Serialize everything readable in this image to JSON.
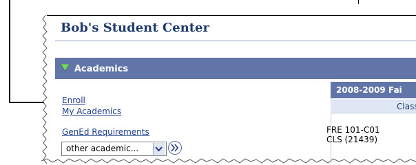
{
  "page": {
    "title": "Bob's Student Center"
  },
  "academics": {
    "header_label": "Academics",
    "links": [
      {
        "label": "Enroll"
      },
      {
        "label": "My Academics"
      },
      {
        "label": "GenEd Requirements"
      }
    ],
    "select": {
      "value": "other academic..."
    }
  },
  "schedule": {
    "term_label": "2008-2009 Fai",
    "column_label": "Class",
    "entry": {
      "line1": "FRE 101-C01",
      "line2": "CLS (21439)"
    }
  },
  "colors": {
    "header_bar": "#6175a8",
    "title_text": "#1f3b6d",
    "link_text": "#1f3f8f",
    "triangle": "#7bd36b"
  },
  "icons": {
    "expand": "triangle-down-icon",
    "select_arrow": "chevron-down-icon",
    "go": "double-chevron-right-icon",
    "callout": "arrow-right-icon"
  }
}
